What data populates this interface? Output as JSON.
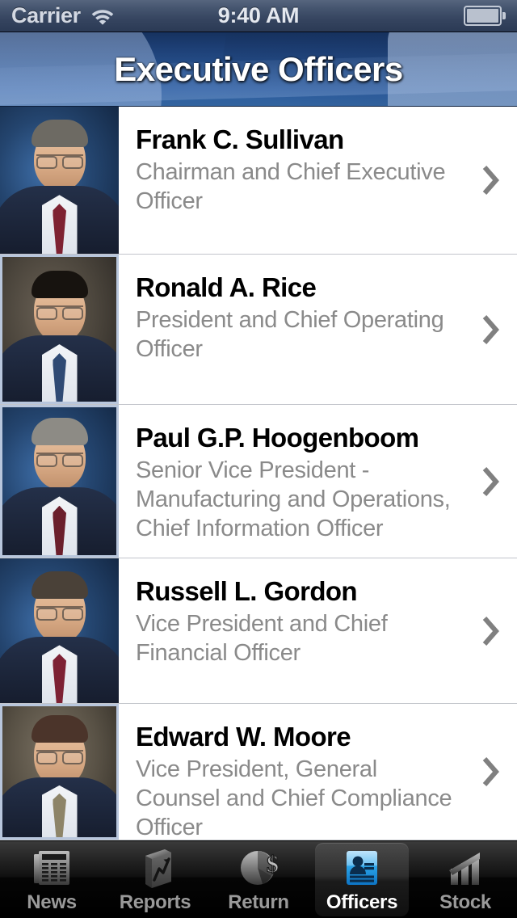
{
  "status_bar": {
    "carrier": "Carrier",
    "wifi_icon": "wifi-icon",
    "time": "9:40 AM",
    "battery_icon": "battery-icon"
  },
  "nav": {
    "title": "Executive Officers"
  },
  "list": {
    "disclosure_icon": "chevron-right-icon",
    "rows": [
      {
        "name": "Frank C. Sullivan",
        "title": "Chairman and Chief Executive Officer",
        "photo": "portrait-frank-sullivan",
        "bg": "blue",
        "hair": "#6d6a63",
        "tie": "#7e2232",
        "framed": false
      },
      {
        "name": "Ronald A. Rice",
        "title": "President and Chief Operating Officer",
        "photo": "portrait-ronald-rice",
        "bg": "gray",
        "hair": "#17130f",
        "tie": "#2f4a74",
        "framed": true
      },
      {
        "name": "Paul G.P. Hoogenboom",
        "title": "Senior Vice President - Manufacturing and Operations, Chief Information Officer",
        "photo": "portrait-paul-hoogenboom",
        "bg": "blue",
        "hair": "#8d8b85",
        "tie": "#6b1f2c",
        "framed": true
      },
      {
        "name": "Russell L. Gordon",
        "title": "Vice President and Chief Financial Officer",
        "photo": "portrait-russell-gordon",
        "bg": "blue",
        "hair": "#4a4138",
        "tie": "#7d2134",
        "framed": false
      },
      {
        "name": "Edward W. Moore",
        "title": "Vice President, General Counsel and Chief Compliance Officer",
        "photo": "portrait-edward-moore",
        "bg": "brown",
        "hair": "#4b342a",
        "tie": "#8d8468",
        "framed": true
      }
    ]
  },
  "tabbar": {
    "selected_index": 3,
    "tabs": [
      {
        "label": "News",
        "icon": "newspaper-icon"
      },
      {
        "label": "Reports",
        "icon": "book-chart-icon"
      },
      {
        "label": "Return",
        "icon": "pie-dollar-icon"
      },
      {
        "label": "Officers",
        "icon": "id-card-person-icon"
      },
      {
        "label": "Stock",
        "icon": "bar-chart-icon"
      }
    ]
  },
  "colors": {
    "nav_blue": "#27528f",
    "accent_blue": "#36a7e8",
    "subtitle_gray": "#8a8a8a",
    "chevron_gray": "#808080",
    "separator": "#c2c5cb"
  }
}
